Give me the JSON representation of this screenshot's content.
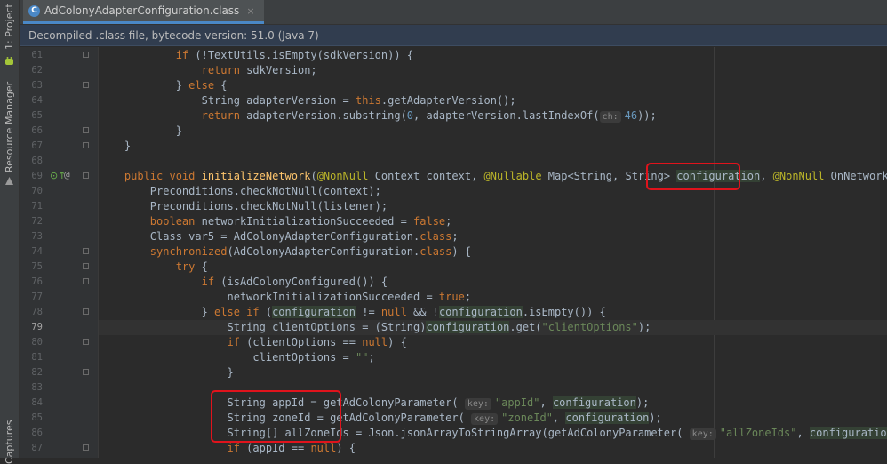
{
  "side_tools": [
    "1: Project",
    "Resource Manager",
    "Captures"
  ],
  "tab": {
    "title": "AdColonyAdapterConfiguration.class",
    "icon": "class-icon",
    "close": "×"
  },
  "notice": "Decompiled .class file, bytecode version: 51.0 (Java 7)",
  "current_line": "79",
  "lines": [
    {
      "n": "61",
      "html": "            <span class=\"kw\">if</span> (!TextUtils.isEmpty(sdkVersion)) {"
    },
    {
      "n": "62",
      "html": "                <span class=\"kw\">return</span> sdkVersion;"
    },
    {
      "n": "63",
      "html": "            } <span class=\"kw\">else</span> {"
    },
    {
      "n": "64",
      "html": "                String adapterVersion = <span class=\"kw\">this</span>.getAdapterVersion();"
    },
    {
      "n": "65",
      "html": "                <span class=\"kw\">return</span> adapterVersion.substring(<span class=\"num\">0</span>, adapterVersion.lastIndexOf(<span class=\"hint\">ch:</span><span class=\"num\">46</span>));"
    },
    {
      "n": "66",
      "html": "            }"
    },
    {
      "n": "67",
      "html": "    }"
    },
    {
      "n": "68",
      "html": ""
    },
    {
      "n": "69",
      "html": "    <span class=\"kw\">public void</span> <span class=\"fn\">initializeNetwork</span>(<span class=\"ann\">@NonNull</span> Context context, <span class=\"ann\">@Nullable</span> Map&lt;String, String&gt; <span class=\"hl\">configuration</span>, <span class=\"ann\">@NonNull</span> OnNetworkIniti"
    },
    {
      "n": "70",
      "html": "        Preconditions.checkNotNull(context);"
    },
    {
      "n": "71",
      "html": "        Preconditions.checkNotNull(listener);"
    },
    {
      "n": "72",
      "html": "        <span class=\"kw\">boolean</span> networkInitializationSucceeded = <span class=\"kw\">false</span>;"
    },
    {
      "n": "73",
      "html": "        Class var5 = AdColonyAdapterConfiguration.<span class=\"kw\">class</span>;"
    },
    {
      "n": "74",
      "html": "        <span class=\"kw\">synchronized</span>(AdColonyAdapterConfiguration.<span class=\"kw\">class</span>) {"
    },
    {
      "n": "75",
      "html": "            <span class=\"kw\">try</span> {"
    },
    {
      "n": "76",
      "html": "                <span class=\"kw\">if</span> (isAdColonyConfigured()) {"
    },
    {
      "n": "77",
      "html": "                    networkInitializationSucceeded = <span class=\"kw\">true</span>;"
    },
    {
      "n": "78",
      "html": "                } <span class=\"kw\">else if</span> (<span class=\"hl\">configuration</span> != <span class=\"kw\">null</span> &amp;&amp; !<span class=\"hl\">configuration</span>.isEmpty()) {"
    },
    {
      "n": "79",
      "html": "                    String clientOptions = (String)<span class=\"hl\">configuration</span>.get(<span class=\"str\">\"clientOptions\"</span>);"
    },
    {
      "n": "80",
      "html": "                    <span class=\"kw\">if</span> (clientOptions == <span class=\"kw\">null</span>) {"
    },
    {
      "n": "81",
      "html": "                        clientOptions = <span class=\"str\">\"\"</span>;"
    },
    {
      "n": "82",
      "html": "                    }"
    },
    {
      "n": "83",
      "html": ""
    },
    {
      "n": "84",
      "html": "                    String appId = getAdColonyParameter( <span class=\"hint\">key:</span><span class=\"str\">\"appId\"</span>, <span class=\"hl\">configuration</span>);"
    },
    {
      "n": "85",
      "html": "                    String zoneId = getAdColonyParameter( <span class=\"hint\">key:</span><span class=\"str\">\"zoneId\"</span>, <span class=\"hl\">configuration</span>);"
    },
    {
      "n": "86",
      "html": "                    String[] allZoneIds = Json.jsonArrayToStringArray(getAdColonyParameter( <span class=\"hint\">key:</span><span class=\"str\">\"allZoneIds\"</span>, <span class=\"hl\">configuration</span>));"
    },
    {
      "n": "87",
      "html": "                    <span class=\"kw\">if</span> (appId == <span class=\"kw\">null</span>) {"
    }
  ],
  "folds": [
    "61",
    "63",
    "66",
    "67",
    "69",
    "74",
    "75",
    "76",
    "78",
    "80",
    "82",
    "87"
  ],
  "gutter_markers": {
    "69": "override-up-icon",
    "79": "bulb-icon"
  }
}
